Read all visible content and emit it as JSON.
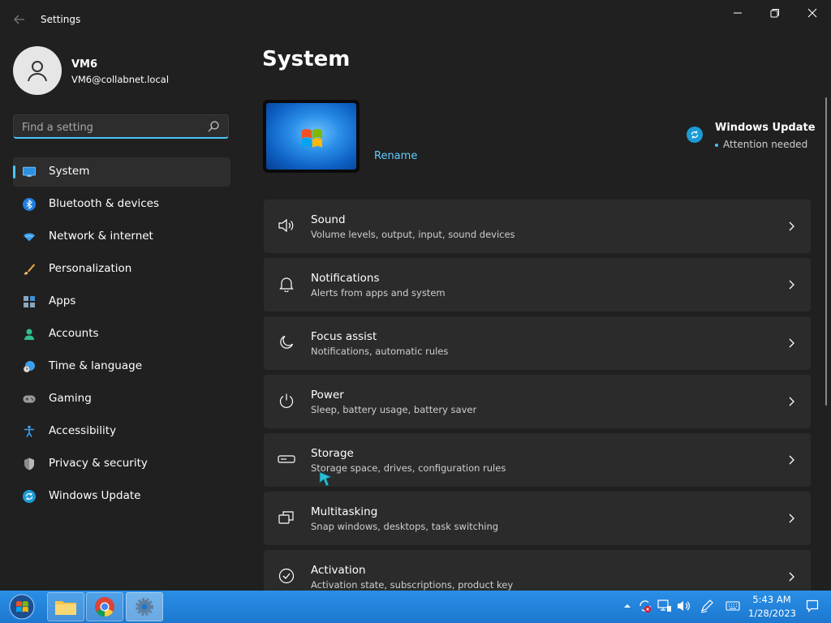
{
  "window": {
    "title": "Settings",
    "back_icon": "back-arrow-icon",
    "minimize_icon": "minimize-icon",
    "maximize_icon": "restore-icon",
    "close_icon": "close-icon"
  },
  "profile": {
    "name": "VM6",
    "email": "VM6@collabnet.local",
    "avatar_icon": "person-icon"
  },
  "search": {
    "placeholder": "Find a setting",
    "value": "",
    "icon": "search-icon"
  },
  "sidebar": {
    "items": [
      {
        "label": "System",
        "icon": "monitor-icon",
        "active": true
      },
      {
        "label": "Bluetooth & devices",
        "icon": "bluetooth-icon"
      },
      {
        "label": "Network & internet",
        "icon": "wifi-icon"
      },
      {
        "label": "Personalization",
        "icon": "brush-icon"
      },
      {
        "label": "Apps",
        "icon": "apps-icon"
      },
      {
        "label": "Accounts",
        "icon": "account-icon"
      },
      {
        "label": "Time & language",
        "icon": "clock-globe-icon"
      },
      {
        "label": "Gaming",
        "icon": "gamepad-icon"
      },
      {
        "label": "Accessibility",
        "icon": "accessibility-icon"
      },
      {
        "label": "Privacy & security",
        "icon": "shield-icon"
      },
      {
        "label": "Windows Update",
        "icon": "sync-icon"
      }
    ]
  },
  "main": {
    "title": "System",
    "rename_label": "Rename",
    "windows_update": {
      "title": "Windows Update",
      "status": "Attention needed"
    },
    "cards": [
      {
        "title": "Sound",
        "subtitle": "Volume levels, output, input, sound devices",
        "icon": "speaker-icon"
      },
      {
        "title": "Notifications",
        "subtitle": "Alerts from apps and system",
        "icon": "bell-icon"
      },
      {
        "title": "Focus assist",
        "subtitle": "Notifications, automatic rules",
        "icon": "moon-icon"
      },
      {
        "title": "Power",
        "subtitle": "Sleep, battery usage, battery saver",
        "icon": "power-icon"
      },
      {
        "title": "Storage",
        "subtitle": "Storage space, drives, configuration rules",
        "icon": "storage-icon"
      },
      {
        "title": "Multitasking",
        "subtitle": "Snap windows, desktops, task switching",
        "icon": "multitask-icon"
      },
      {
        "title": "Activation",
        "subtitle": "Activation state, subscriptions, product key",
        "icon": "check-circle-icon"
      }
    ]
  },
  "taskbar": {
    "apps": [
      "File Explorer",
      "Google Chrome",
      "Settings"
    ],
    "clock_time": "5:43 AM",
    "clock_date": "1/28/2023"
  },
  "colors": {
    "background": "#202020",
    "card": "#2b2b2b",
    "accent": "#4cc2ff",
    "link": "#60cdff",
    "taskbar": "#1c78cf"
  }
}
